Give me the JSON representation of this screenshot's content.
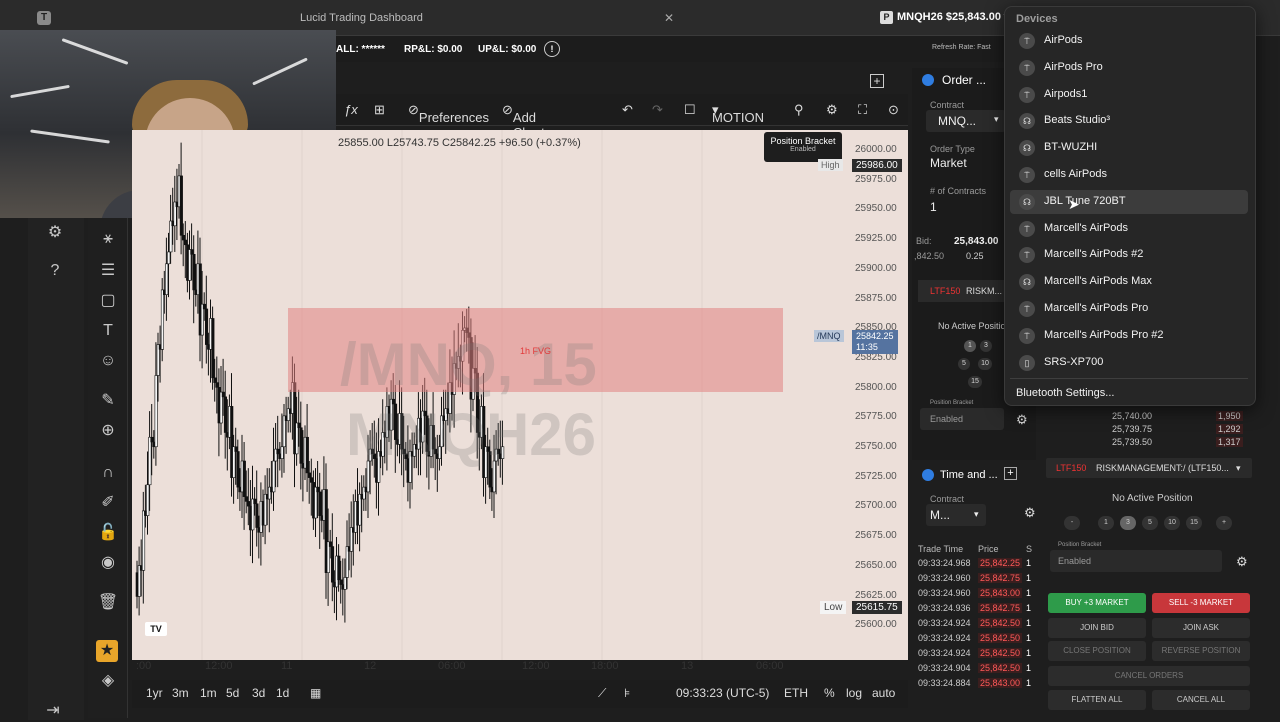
{
  "window": {
    "title": "Lucid Trading Dashboard",
    "ticker_account": "MNQH26 $25,843.00 ▾",
    "refresh_rate": "Refresh Rate: Fast"
  },
  "account_bar": {
    "account_masked": "ALL: ******",
    "rpl": "RP&L: $0.00",
    "upl": "UP&L: $0.00"
  },
  "chart_toolbar": {
    "fx": "ƒx",
    "preferences": "Preferences",
    "add_chart_link": "Add Chart Link",
    "motion": "MOTION"
  },
  "chart": {
    "ohlc": "25855.00  L25743.75  C25842.25  +96.50 (+0.37%)",
    "watermark_symbol": "/MNQ, 15",
    "watermark_contract": "MNQH26",
    "fvg_label": "1h FVG",
    "high_tag": "High",
    "high_value": "25986.00",
    "low_tag": "Low",
    "low_value": "25615.75",
    "symbol_tag": "/MNQ",
    "last_price": "25842.25",
    "countdown": "11:35",
    "position_bracket_title": "Position Bracket",
    "position_bracket_status": "Enabled",
    "y_ticks": [
      "26000.00",
      "25975.00",
      "25950.00",
      "25925.00",
      "25900.00",
      "25875.00",
      "25850.00",
      "25825.00",
      "25800.00",
      "25775.00",
      "25750.00",
      "25725.00",
      "25700.00",
      "25675.00",
      "25650.00",
      "25625.00",
      "25600.00"
    ],
    "x_ticks": [
      ":00",
      "12:00",
      "11",
      "12",
      "06:00",
      "12:00",
      "18:00",
      "13",
      "06:00"
    ]
  },
  "bottom_bar": {
    "ranges": [
      "1yr",
      "3m",
      "1m",
      "5d",
      "3d",
      "1d"
    ],
    "time": "09:33:23 (UTC-5)",
    "session": "ETH",
    "pct": "%",
    "log": "log",
    "auto": "auto"
  },
  "order_panel": {
    "title": "Order ...",
    "contract_label": "Contract",
    "contract_value": "MNQ...",
    "order_type_label": "Order Type",
    "order_type_value": "Market",
    "contracts_label": "# of Contracts",
    "contracts_value": "1",
    "bid_label": "Bid:",
    "bid_value": "25,843.00",
    "bid_sub": ",842.50",
    "tick": "0.25",
    "risk_label": "RISKM...",
    "risk_tag": "LTF150",
    "no_position": "No Active Positio",
    "qty_buttons": [
      "1",
      "3",
      "5",
      "10",
      "15"
    ],
    "bracket_label": "Position Bracket",
    "bracket_value": "Enabled"
  },
  "time_sales": {
    "title": "Time and ...",
    "contract_label": "Contract",
    "contract_value": "M...",
    "col_time": "Trade Time",
    "col_price": "Price",
    "col_size": "S",
    "rows": [
      {
        "t": "09:33:24.968",
        "p": "25,842.25",
        "s": "1"
      },
      {
        "t": "09:33:24.960",
        "p": "25,842.75",
        "s": "1"
      },
      {
        "t": "09:33:24.960",
        "p": "25,843.00",
        "s": "1"
      },
      {
        "t": "09:33:24.936",
        "p": "25,842.75",
        "s": "1"
      },
      {
        "t": "09:33:24.924",
        "p": "25,842.50",
        "s": "1"
      },
      {
        "t": "09:33:24.924",
        "p": "25,842.50",
        "s": "1"
      },
      {
        "t": "09:33:24.924",
        "p": "25,842.50",
        "s": "1"
      },
      {
        "t": "09:33:24.904",
        "p": "25,842.50",
        "s": "1"
      },
      {
        "t": "09:33:24.884",
        "p": "25,843.00",
        "s": "1"
      }
    ]
  },
  "risk_panel": {
    "book": [
      {
        "p": "25,740.00",
        "s": "1,950"
      },
      {
        "p": "25,739.75",
        "s": "1,292"
      },
      {
        "p": "25,739.50",
        "s": "1,317"
      }
    ],
    "risk_tag": "LTF150",
    "risk_name": "RISKMANAGEMENT:/ (LTF150...",
    "no_position": "No Active Position",
    "qty_buttons": [
      "-",
      "1",
      "3",
      "5",
      "10",
      "15",
      "+"
    ],
    "bracket_label": "Position Bracket",
    "bracket_value": "Enabled",
    "buy": "BUY +3 MARKET",
    "sell": "SELL -3 MARKET",
    "join_bid": "JOIN BID",
    "join_ask": "JOIN ASK",
    "close_position": "CLOSE POSITION",
    "reverse_position": "REVERSE POSITION",
    "cancel_orders": "CANCEL ORDERS",
    "flatten_all": "FLATTEN ALL",
    "cancel_all": "CANCEL ALL",
    "colors": {
      "buy": "#2e9b4a",
      "sell": "#c8373b"
    }
  },
  "devices_menu": {
    "title": "Devices",
    "items": [
      {
        "name": "AirPods",
        "icon": "airpods-icon"
      },
      {
        "name": "AirPods Pro",
        "icon": "airpods-icon"
      },
      {
        "name": "Airpods1",
        "icon": "airpods-icon"
      },
      {
        "name": "Beats Studio³",
        "icon": "headphones-icon"
      },
      {
        "name": "BT-WUZHI",
        "icon": "headphones-icon"
      },
      {
        "name": "cells AirPods",
        "icon": "airpods-icon"
      },
      {
        "name": "JBL Tune 720BT",
        "icon": "headphones-icon"
      },
      {
        "name": "Marcell's AirPods",
        "icon": "airpods-icon"
      },
      {
        "name": "Marcell's AirPods #2",
        "icon": "airpods-icon"
      },
      {
        "name": "Marcell's AirPods Max",
        "icon": "headphones-icon"
      },
      {
        "name": "Marcell's AirPods Pro",
        "icon": "airpods-icon"
      },
      {
        "name": "Marcell's AirPods Pro #2",
        "icon": "airpods-icon"
      },
      {
        "name": "SRS-XP700",
        "icon": "speaker-icon"
      }
    ],
    "selected_index": 6,
    "bluetooth_settings": "Bluetooth Settings..."
  }
}
